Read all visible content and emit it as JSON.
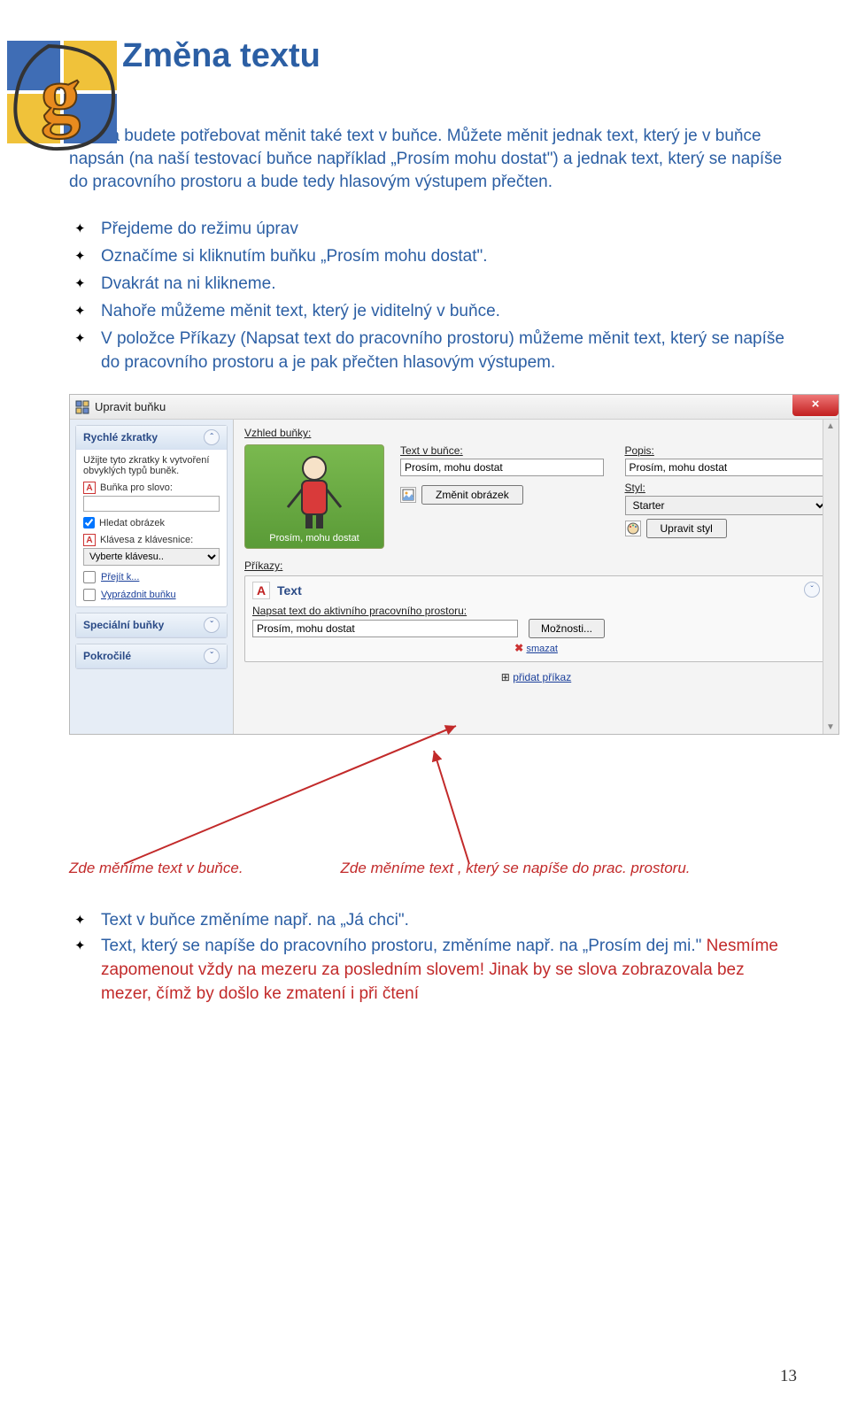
{
  "title": "Změna textu",
  "para1": "Možná budete potřebovat měnit také text v buňce. Můžete měnit jednak text, který je v buňce napsán (na naší testovací buňce například „Prosím mohu dostat\") a jednak text, který se napíše do pracovního prostoru a bude tedy hlasovým výstupem přečten.",
  "bullets1": {
    "b1": "Přejdeme do režimu úprav",
    "b2": "Označíme si kliknutím buňku „Prosím mohu dostat\".",
    "b3": "Dvakrát na ni klikneme.",
    "b4": "Nahoře můžeme měnit text, který je viditelný v buňce.",
    "b5": "V položce Příkazy (Napsat text do pracovního prostoru) můžeme měnit text, který se napíše do pracovního prostoru a je pak přečten hlasovým výstupem."
  },
  "shot": {
    "titlebar": "Upravit buňku",
    "close_x": "×",
    "side": {
      "quick_head": "Rychlé zkratky",
      "quick_desc": "Užijte tyto zkratky k vytvoření obvyklých typů buněk.",
      "word_cell": "Buňka pro slovo:",
      "word_val": "",
      "search_pic": "Hledat obrázek",
      "key_label": "Klávesa z klávesnice:",
      "key_val": "Vyberte klávesu..",
      "goto": "Přejít k...",
      "empty": "Vyprázdnit buňku",
      "special_head": "Speciální buňky",
      "adv_head": "Pokročilé"
    },
    "main": {
      "appearance": "Vzhled buňky:",
      "cell_text_lbl": "Text v buňce:",
      "cell_text_val": "Prosím, mohu dostat",
      "desc_lbl": "Popis:",
      "desc_val": "Prosím, mohu dostat",
      "style_lbl": "Styl:",
      "style_val": "Starter",
      "preview_caption": "Prosím, mohu dostat",
      "change_pic": "Změnit obrázek",
      "edit_style": "Upravit styl",
      "commands_lbl": "Příkazy:",
      "cmd_head": "Text",
      "cmd_sublabel": "Napsat text do aktivního pracovního prostoru:",
      "cmd_val": "Prosím, mohu dostat",
      "options": "Možnosti...",
      "delete": "smazat",
      "add_cmd": "přidat příkaz"
    }
  },
  "cap1": "Zde měníme text v buňce.",
  "cap2": "Zde měníme text , který se napíše do prac. prostoru.",
  "bullets2": {
    "b1": "Text v buňce změníme např. na „Já chci\".",
    "b2a": "Text, který se napíše do pracovního prostoru, změníme např. na „Prosím dej mi.\" ",
    "b2_red": "Nesmíme zapomenout vždy na mezeru za posledním slovem! Jinak by se slova zobrazovala bez mezer, čímž by došlo ke zmatení i při čtení"
  },
  "page_number": "13"
}
